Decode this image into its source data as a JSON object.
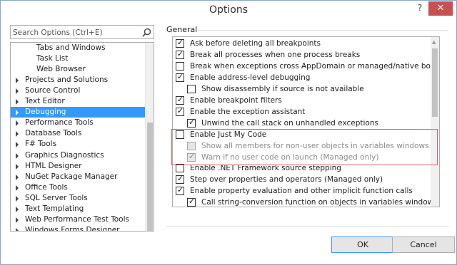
{
  "window": {
    "title": "Options",
    "help_label": "?",
    "close_label": "✕"
  },
  "search": {
    "placeholder": "Search Options (Ctrl+E)"
  },
  "tree": {
    "items": [
      {
        "label": "Tabs and Windows",
        "expandable": false,
        "selected": false
      },
      {
        "label": "Task List",
        "expandable": false,
        "selected": false
      },
      {
        "label": "Web Browser",
        "expandable": false,
        "selected": false
      },
      {
        "label": "Projects and Solutions",
        "expandable": true,
        "selected": false
      },
      {
        "label": "Source Control",
        "expandable": true,
        "selected": false
      },
      {
        "label": "Text Editor",
        "expandable": true,
        "selected": false
      },
      {
        "label": "Debugging",
        "expandable": true,
        "selected": true
      },
      {
        "label": "Performance Tools",
        "expandable": true,
        "selected": false
      },
      {
        "label": "Database Tools",
        "expandable": true,
        "selected": false
      },
      {
        "label": "F# Tools",
        "expandable": true,
        "selected": false
      },
      {
        "label": "Graphics Diagnostics",
        "expandable": true,
        "selected": false
      },
      {
        "label": "HTML Designer",
        "expandable": true,
        "selected": false
      },
      {
        "label": "NuGet Package Manager",
        "expandable": true,
        "selected": false
      },
      {
        "label": "Office Tools",
        "expandable": true,
        "selected": false
      },
      {
        "label": "SQL Server Tools",
        "expandable": true,
        "selected": false
      },
      {
        "label": "Text Templating",
        "expandable": true,
        "selected": false
      },
      {
        "label": "Web Performance Test Tools",
        "expandable": true,
        "selected": false
      },
      {
        "label": "Windows Forms Designer",
        "expandable": true,
        "selected": false
      }
    ]
  },
  "section": {
    "label": "General"
  },
  "options": [
    {
      "label": "Ask before deleting all breakpoints",
      "checked": true,
      "indent": 0,
      "disabled": false
    },
    {
      "label": "Break all processes when one process breaks",
      "checked": true,
      "indent": 0,
      "disabled": false
    },
    {
      "label": "Break when exceptions cross AppDomain or managed/native boundaries (M",
      "checked": false,
      "indent": 0,
      "disabled": false
    },
    {
      "label": "Enable address-level debugging",
      "checked": true,
      "indent": 0,
      "disabled": false
    },
    {
      "label": "Show disassembly if source is not available",
      "checked": false,
      "indent": 1,
      "disabled": false
    },
    {
      "label": "Enable breakpoint filters",
      "checked": true,
      "indent": 0,
      "disabled": false
    },
    {
      "label": "Enable the exception assistant",
      "checked": true,
      "indent": 0,
      "disabled": false
    },
    {
      "label": "Unwind the call stack on unhandled exceptions",
      "checked": true,
      "indent": 1,
      "disabled": false
    },
    {
      "label": "Enable Just My Code",
      "checked": false,
      "indent": 0,
      "disabled": false
    },
    {
      "label": "Show all members for non-user objects in variables windows (Visual Basi",
      "checked": false,
      "indent": 1,
      "disabled": true
    },
    {
      "label": "Warn if no user code on launch (Managed only)",
      "checked": true,
      "indent": 1,
      "disabled": true
    },
    {
      "label": "Enable .NET Framework source stepping",
      "checked": false,
      "indent": 0,
      "disabled": false
    },
    {
      "label": "Step over properties and operators (Managed only)",
      "checked": true,
      "indent": 0,
      "disabled": false
    },
    {
      "label": "Enable property evaluation and other implicit function calls",
      "checked": true,
      "indent": 0,
      "disabled": false
    },
    {
      "label": "Call string-conversion function on objects in variables windows",
      "checked": true,
      "indent": 1,
      "disabled": false
    }
  ],
  "buttons": {
    "ok": "OK",
    "cancel": "Cancel"
  },
  "colors": {
    "selection": "#3399ff",
    "highlight_box": "#e85a5a",
    "close_button": "#c75050"
  }
}
